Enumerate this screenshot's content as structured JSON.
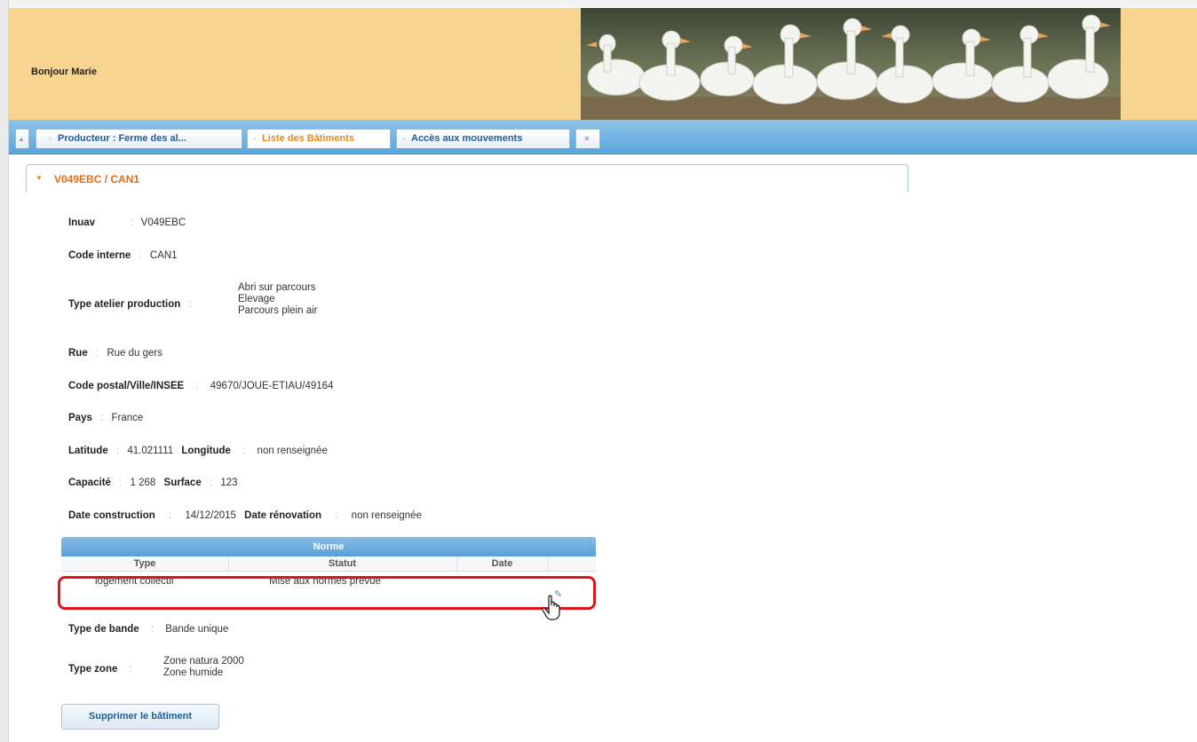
{
  "header": {
    "greeting": "Bonjour Marie",
    "banner_image": "white-ducks-photo"
  },
  "tabs": [
    {
      "label": "",
      "icon": "home-icon"
    },
    {
      "label": "Producteur : Ferme des al...",
      "icon": "document-icon"
    },
    {
      "label": "Liste des Bâtiments",
      "icon": "document-icon",
      "active": true
    },
    {
      "label": "Accès aux mouvements",
      "icon": "document-icon"
    },
    {
      "label": "",
      "icon": "close-icon"
    }
  ],
  "accordion": {
    "title": "V049EBC / CAN1"
  },
  "fields": {
    "inuav": {
      "label": "Inuav",
      "value": "V049EBC"
    },
    "code_interne": {
      "label": "Code interne",
      "value": "CAN1"
    },
    "type_atelier": {
      "label": "Type atelier production",
      "values": [
        "Abri sur parcours",
        "Elevage",
        "Parcours plein air"
      ]
    },
    "rue": {
      "label": "Rue",
      "value": "Rue du gers"
    },
    "code_postal": {
      "label": "Code postal/Ville/INSEE",
      "value": "49670/JOUE-ETIAU/49164"
    },
    "pays": {
      "label": "Pays",
      "value": "France"
    },
    "latitude": {
      "label": "Latitude",
      "value": "41.021111"
    },
    "longitude": {
      "label": "Longitude",
      "value": "non renseignée"
    },
    "capacite": {
      "label": "Capacité",
      "value": "1 268"
    },
    "surface": {
      "label": "Surface",
      "value": "123"
    },
    "date_construction": {
      "label": "Date construction",
      "value": "14/12/2015"
    },
    "date_renovation": {
      "label": "Date rénovation",
      "value": "non renseignée"
    },
    "type_bande": {
      "label": "Type de bande",
      "value": "Bande unique"
    },
    "type_zone": {
      "label": "Type zone",
      "values": [
        "Zone natura 2000",
        "Zone humide"
      ]
    }
  },
  "separator": ":",
  "norme": {
    "title": "Norme",
    "columns": [
      "Type",
      "Statut",
      "Date"
    ],
    "rows": [
      {
        "type": "logement collectif",
        "statut": "Mise aux normes prévue",
        "date": ""
      }
    ]
  },
  "actions": {
    "delete_label": "Supprimer le bâtiment"
  },
  "colors": {
    "header_bg": "#f8d491",
    "tabbar_blue": "#5aa6db",
    "accent_orange": "#e06d16",
    "highlight_red": "#e0151a"
  }
}
